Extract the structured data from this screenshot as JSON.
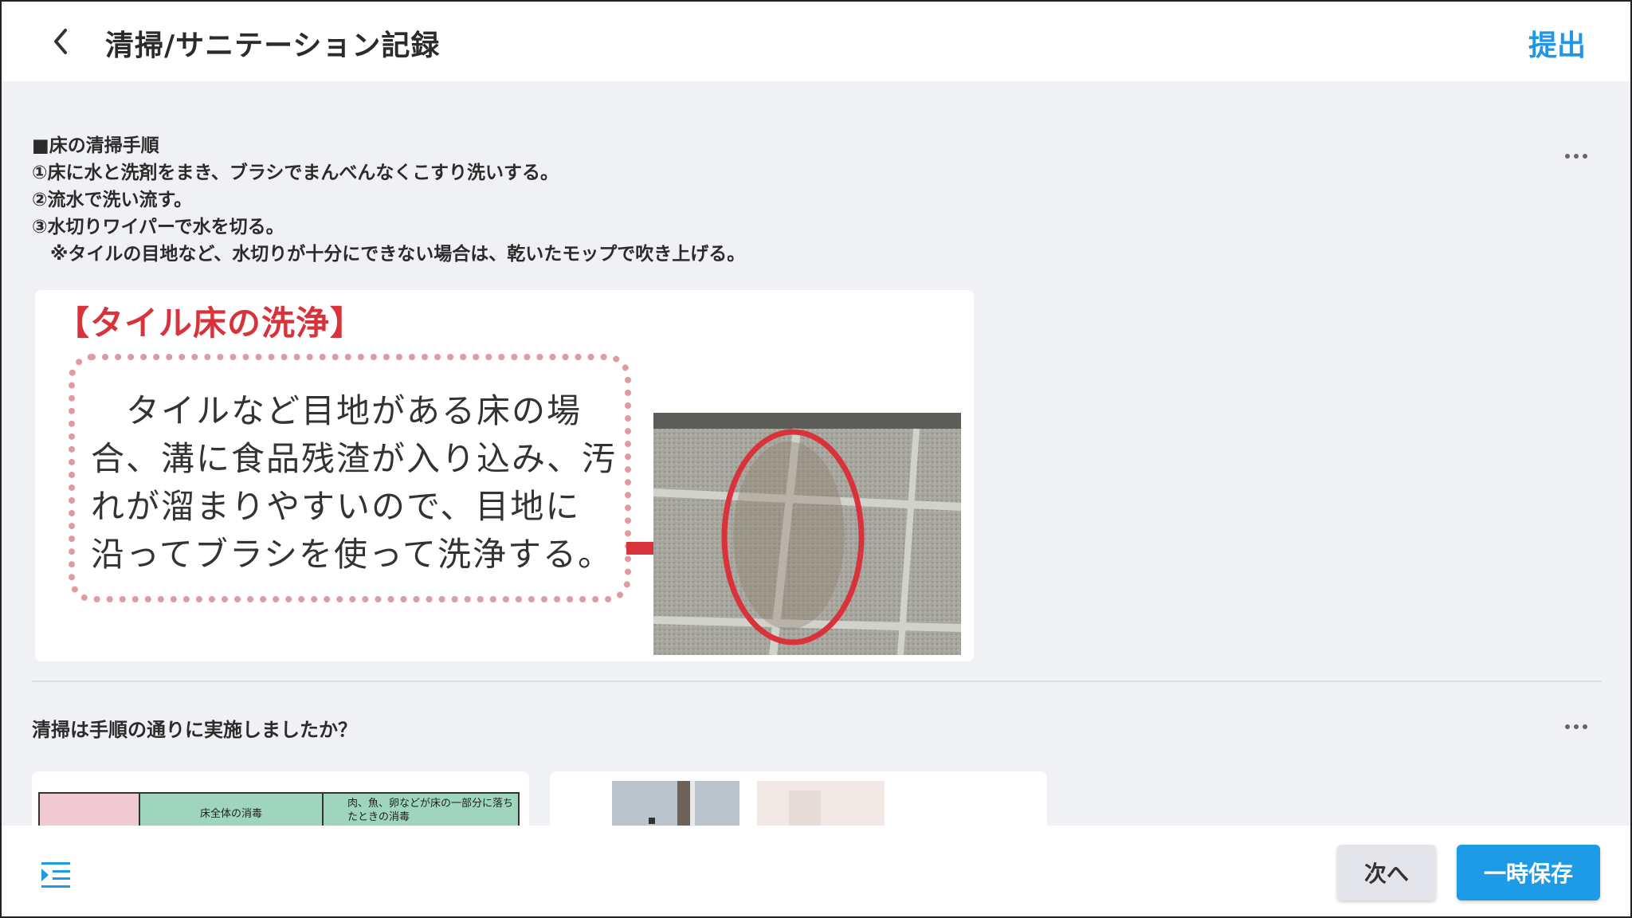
{
  "header": {
    "title": "清掃/サニテーション記録",
    "submit_label": "提出",
    "back_icon": "chevron-left-icon"
  },
  "step1": {
    "instruction_lines": [
      "■床の清掃手順",
      "①床に水と洗剤をまき、ブラシでまんべんなくこすり洗いする。",
      "②流水で洗い流す。",
      "③水切りワイパーで水を切る。",
      "　※タイルの目地など、水切りが十分にできない場合は、乾いたモップで吹き上げる。"
    ],
    "image": {
      "heading": "【タイル床の洗浄】",
      "box_lines": [
        "　タイルなど目地がある床の場",
        "合、溝に食品残渣が入り込み、汚",
        "れが溜まりやすいので、目地に",
        "沿ってブラシを使って洗浄する。"
      ]
    }
  },
  "step2": {
    "question": "清掃は手順の通りに実施しましたか？",
    "thumb1": {
      "col2": "床全体の消毒",
      "col3": "肉、魚、卵などが床の一部分に落ちたときの消毒"
    }
  },
  "footer": {
    "next_label": "次へ",
    "save_label": "一時保存"
  },
  "colors": {
    "accent": "#1e9be6",
    "heading_red": "#d8333a"
  }
}
